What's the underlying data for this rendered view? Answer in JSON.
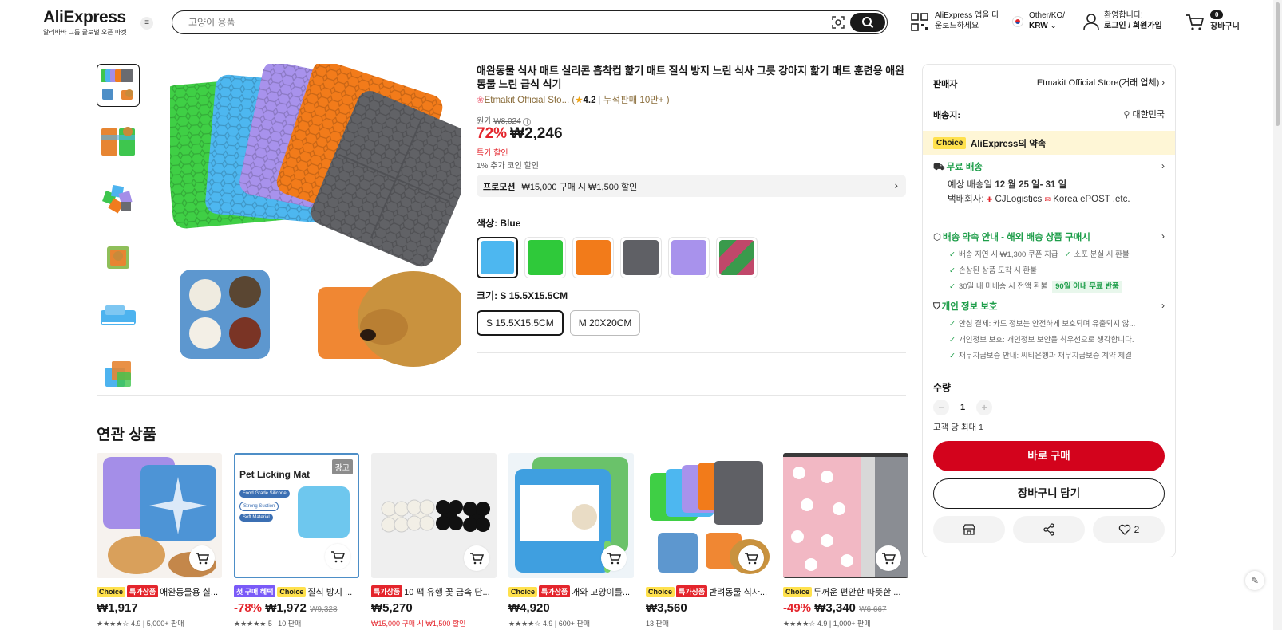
{
  "header": {
    "logo": "AliExpress",
    "logo_sub": "알리바바 그룹 글로벌 오픈 마켓",
    "search_placeholder": "고양이 용품",
    "app_line1": "AliExpress 앱을 다",
    "app_line2": "운로드하세요",
    "region_line1": "Other/KO/",
    "region_line2": "KRW",
    "account_line1": "환영합니다!",
    "account_line2": "로그인 / 회원가입",
    "cart_count": "0",
    "cart_label": "장바구니"
  },
  "product": {
    "title": "애완동물 식사 매트 실리콘 흡착컵 핥기 매트 질식 방지 느린 식사 그릇 강아지 핥기 매트 훈련용 애완동물 느린 급식 식기",
    "store_name": "Etmakit Official Sto...",
    "rating": "4.2",
    "sold": "누적판매 10만+",
    "orig_label": "원가",
    "orig_price": "₩8,024",
    "discount": "72%",
    "price": "₩2,246",
    "deal_label": "특가 할인",
    "coin_text": "1% 추가 코인 할인",
    "promo_label": "프로모션",
    "promo_text": "₩15,000 구매 시 ₩1,500 할인",
    "color_label": "색상: Blue",
    "colors": [
      "Blue",
      "Green",
      "Orange",
      "Gray",
      "Purple",
      "Mixed"
    ],
    "size_label": "크기: S 15.5X15.5CM",
    "sizes": [
      "S 15.5X15.5CM",
      "M 20X20CM"
    ]
  },
  "related": {
    "heading": "연관 상품",
    "ad_label": "광고",
    "items": [
      {
        "badges": [
          "Choice",
          "특가상품"
        ],
        "name": "애완동물용 실...",
        "discount": "",
        "price": "₩1,917",
        "orig": "",
        "meta": "★★★★☆ 4.9 | 5,000+ 판매"
      },
      {
        "badges": [
          "첫 구매 혜택",
          "Choice"
        ],
        "name": "질식 방지 ...",
        "discount": "-78%",
        "price": "₩1,972",
        "orig": "₩9,328",
        "meta": "★★★★★ 5 | 10 판매",
        "img_title": "Pet Licking Mat",
        "img_tags": [
          "Food Grade Silicone",
          "Strong Suction",
          "Soft Material"
        ]
      },
      {
        "badges": [
          "특가상품"
        ],
        "name": "10 팩 유행 꽃 금속 단...",
        "discount": "",
        "price": "₩5,270",
        "orig": "",
        "meta": "₩15,000 구매 시 ₩1,500 할인"
      },
      {
        "badges": [
          "Choice",
          "특가상품"
        ],
        "name": "개와 고양이를...",
        "discount": "",
        "price": "₩4,920",
        "orig": "",
        "meta": "★★★★☆ 4.9 | 600+ 판매"
      },
      {
        "badges": [
          "Choice",
          "특가상품"
        ],
        "name": "반려동물 식사...",
        "discount": "",
        "price": "₩3,560",
        "orig": "",
        "meta": "13 판매"
      },
      {
        "badges": [
          "Choice"
        ],
        "name": "두꺼운 편안한 따뜻한 ...",
        "discount": "-49%",
        "price": "₩3,340",
        "orig": "₩6,667",
        "meta": "★★★★☆ 4.9 | 1,000+ 판매"
      }
    ]
  },
  "panel": {
    "seller_label": "판매자",
    "seller_name": "Etmakit Official Store(거래 업체)",
    "ship_label": "배송지:",
    "ship_to": "대한민국",
    "choice_badge": "Choice",
    "choice_title": "AliExpress의 약속",
    "free_ship": "무료 배송",
    "eta_prefix": "예상 배송일",
    "eta": "12 월 25 일- 31 일",
    "carrier_label": "택배회사:",
    "carrier1": "CJLogistics",
    "carrier2": "Korea ePOST ,etc.",
    "promise_title": "배송 약속 안내 - 해외 배송 상품 구매시",
    "promise_items": [
      "배송 지연 시 ₩1,300 쿠폰 지급",
      "소포 분실 시 환불",
      "손상된 상품 도착 시 환불",
      "30일 내 미배송 시 전액 환불"
    ],
    "return_tag": "90일 이내 무료 반품",
    "privacy_title": "개인 정보 보호",
    "privacy_items": [
      "안심 결제: 카드 정보는 안전하게 보호되며 유출되지 않...",
      "개인정보 보호: 개인정보 보안을 최우선으로 생각합니다.",
      "채무지급보증 안내: 씨티은행과 채무지급보증 계약 체결"
    ],
    "qty_label": "수량",
    "qty": "1",
    "max_qty": "고객 당 최대 1",
    "buy_now": "바로 구매",
    "add_cart": "장바구니 담기",
    "wish_count": "2"
  },
  "colors": {
    "accent_red": "#d3031c",
    "price_red": "#e4252c",
    "choice_yellow": "#ffe14d",
    "green": "#1e9e4a"
  }
}
